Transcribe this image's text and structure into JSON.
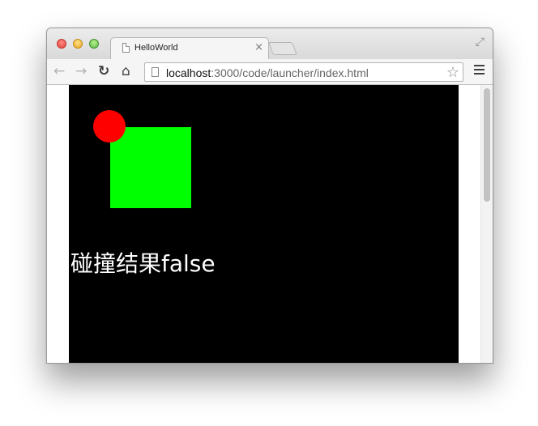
{
  "browser": {
    "tab": {
      "title": "HelloWorld",
      "close_glyph": "×",
      "icon": "document-icon"
    },
    "new_tab_icon": "new-tab-icon",
    "fullscreen_glyph": "⤢",
    "toolbar": {
      "back_glyph": "←",
      "forward_glyph": "→",
      "reload_glyph": "↻",
      "home_glyph": "⌂",
      "menu_icon": "hamburger-menu-icon"
    },
    "address": {
      "host": "localhost",
      "path": ":3000/code/launcher/index.html",
      "star_glyph": "☆"
    }
  },
  "page": {
    "canvas_background": "#000000",
    "shapes": {
      "rect_color": "#00ff00",
      "circle_color": "#ff0000"
    },
    "collision_text": "碰撞结果false"
  },
  "colors": {
    "close_red": "#e0443e",
    "minimize_yellow": "#e9a825",
    "zoom_green": "#5fb84a"
  }
}
